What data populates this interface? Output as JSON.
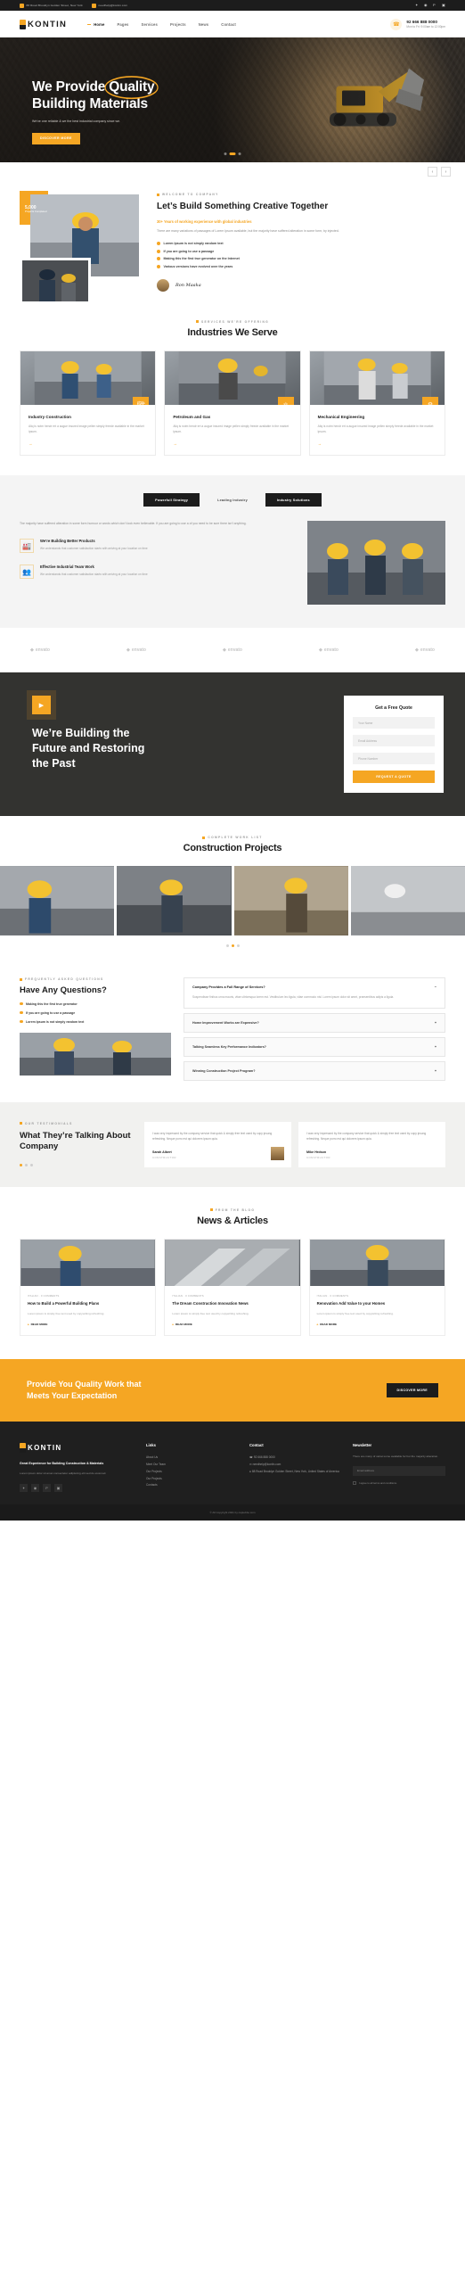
{
  "topbar": {
    "address": "88 Road Brooklyn Golden Street, New York",
    "email": "needhelp@kontin.com",
    "social": [
      "twitter-icon",
      "facebook-icon",
      "pinterest-icon",
      "instagram-icon"
    ]
  },
  "nav": {
    "logo": "KONTIN",
    "menu": [
      "Home",
      "Pages",
      "Services",
      "Projects",
      "News",
      "Contact"
    ],
    "active": "Home",
    "phone": "92 666 888 0000",
    "hours": "Mon to Fri: 9:00am to 12:00pm"
  },
  "hero": {
    "title_line1_a": "We Provide ",
    "title_line1_b": "Quality",
    "title_line2": "Building Materials",
    "paragraph": "We've one reliable & we the best industrial company since we.",
    "button": "DISCOVER MORE",
    "arrow_prev": "‹",
    "arrow_next": "›"
  },
  "about": {
    "label": "WELCOME TO COMPANY",
    "title": "Let’s Build Something Creative Together",
    "subtitle": "30+ Years of working experience with global industries",
    "paragraph": "There are many variations of passages of Lorem Ipsum available, but the majority have suffered alteration in some form, by injected.",
    "stat_number": "5,000",
    "stat_label": "Projects Completed",
    "bullets": [
      "Lorem Ipsum is not simply random text",
      "If you are going to use a passage",
      "Making this the first true generator on the Internet",
      "Various versions have evolved over the years"
    ],
    "signature": "Ron Maaka"
  },
  "services": {
    "label": "SERVICES WE'RE OFFERING",
    "title": "Industries We Serve",
    "cards": [
      {
        "title": "Industry Construction",
        "text": "Aliq is notm hendr ert a augue insured image pellen simply freede available in the market ipsum.",
        "arrow": "→",
        "tag_icon": "building-icon"
      },
      {
        "title": "Petroleum and Gas",
        "text": "Aliq is notm hendr ert a augue insured image pellen simply freede available in the market ipsum.",
        "arrow": "→",
        "tag_icon": "oil-icon"
      },
      {
        "title": "Mechanical Engineering",
        "text": "Aliq is notm hendr ert a augue insured image pellen simply freede available in the market ipsum.",
        "arrow": "→",
        "tag_icon": "gear-icon"
      }
    ]
  },
  "why": {
    "tabs": [
      "Powerfull Strategy",
      "Leading Industry",
      "Industry Solutions"
    ],
    "active_tab": "Leading Industry",
    "paragraph": "The majority have suffered alteration in some form humour or words which don't look even believable. If you are going to use a of you need to be sure there isn't anything.",
    "features": [
      {
        "title": "We're Building Better Products",
        "text": "We understands that customer satisfaction starts with arriving at your location on time",
        "icon": "factory-icon"
      },
      {
        "title": "Effective Industrial Team Work",
        "text": "We understands that customer satisfaction starts with arriving at your location on time",
        "icon": "team-icon"
      }
    ]
  },
  "brands": [
    "envato",
    "envato",
    "envato",
    "envato",
    "envato"
  ],
  "video_quote": {
    "play_icon": "play-icon",
    "heading_line1": "We’re Building the",
    "heading_line2": "Future and Restoring",
    "heading_line3": "the Past",
    "form_title": "Get a Free Quote",
    "fields": [
      "Your Name",
      "Email Address",
      "Phone Number"
    ],
    "submit": "REQUEST A QUOTE"
  },
  "projects": {
    "label": "COMPLETE WORK LIST",
    "title": "Construction Projects"
  },
  "faq": {
    "label": "FREQUENTLY ASKED QUESTIONS",
    "title": "Have Any Questions?",
    "bullets": [
      "Making this the first true generator",
      "If you are going to use a passage",
      "Lorem Ipsum is not simply random text"
    ],
    "items": [
      {
        "question": "Company Provides a Full Range of Services?",
        "open": true,
        "answer": "Suspendisse finibus urna mauris, vitae ultricesqua lorem est. Vestibulum leo ligula, vitae commodo nisl. Lorem ipsum dolor sit amet, praesentibus adipis a ligula."
      },
      {
        "question": "Home Improvement Works are Expensive?",
        "open": false
      },
      {
        "question": "Talking Seamless Key Performance Indicators?",
        "open": false
      },
      {
        "question": "Winning Construction Project Program?",
        "open": false
      }
    ]
  },
  "testimonials": {
    "label": "OUR TESTIMONIALS",
    "title": "What They’re Talking About Company",
    "cards": [
      {
        "quote": "I was very impressed by the company service that quick & simply free text used by copy ipsung refreshing. Neque porro est qui dolorem ipsum quia.",
        "name": "Sarah Albert",
        "role": "CONSTRUCTOR"
      },
      {
        "quote": "I was very impressed by the company service that quick & simply free text used by copy ipsung refreshing. Neque porro est qui dolorem ipsum quia.",
        "name": "Mike Hrdson",
        "role": "CONSTRUCTOR"
      }
    ]
  },
  "news": {
    "label": "FROM THE BLOG",
    "title": "News & Articles",
    "cards": [
      {
        "meta": "ITALIAN · 0 COMMENTS",
        "title": "How to Build a Powerful Building Plans",
        "text": "Lorem ipsum is simply free text used by copywriting refreshing.",
        "read": "READ MORE"
      },
      {
        "meta": "ITALIAN · 0 COMMENTS",
        "title": "The Dream Construction Innovation News",
        "text": "Lorem ipsum is simply free text used by copywriting refreshing.",
        "read": "READ MORE"
      },
      {
        "meta": "ITALIAN · 0 COMMENTS",
        "title": "Renovation Add Value to your Homes",
        "text": "Lorem ipsum is simply free text used by copywriting refreshing.",
        "read": "READ MORE"
      }
    ]
  },
  "cta": {
    "line1": "Provide You Quality Work that",
    "line2": "Meets Your Expectation",
    "button": "DISCOVER MORE"
  },
  "footer": {
    "logo": "KONTIN",
    "tagline": "Great Experience for Building Construction & Materials",
    "desc": "Lorem ipsum dolor sit amet consectetur adipiscing elit sed do eiusmod.",
    "links_title": "Links",
    "links": [
      "About Us",
      "Meet Our Team",
      "Our Projects",
      "Our Projects",
      "Contacts"
    ],
    "contact_title": "Contact",
    "contact": [
      "92 666 888 0000",
      "needhelp@kontin.com",
      "88 Road Brooklyn Golden Street, New York, United States of America"
    ],
    "newsletter_title": "Newsletter",
    "newsletter_text": "There are many of variat some available for but the majority alteration.",
    "newsletter_placeholder": "Email address",
    "newsletter_consent": "I agree to all terms and conditions.",
    "copyright": "© All Copyright 2021 by captebbo.com"
  },
  "colors": {
    "accent": "#f5a623",
    "dark": "#1c1c1c",
    "muted": "#9a9a9a"
  }
}
